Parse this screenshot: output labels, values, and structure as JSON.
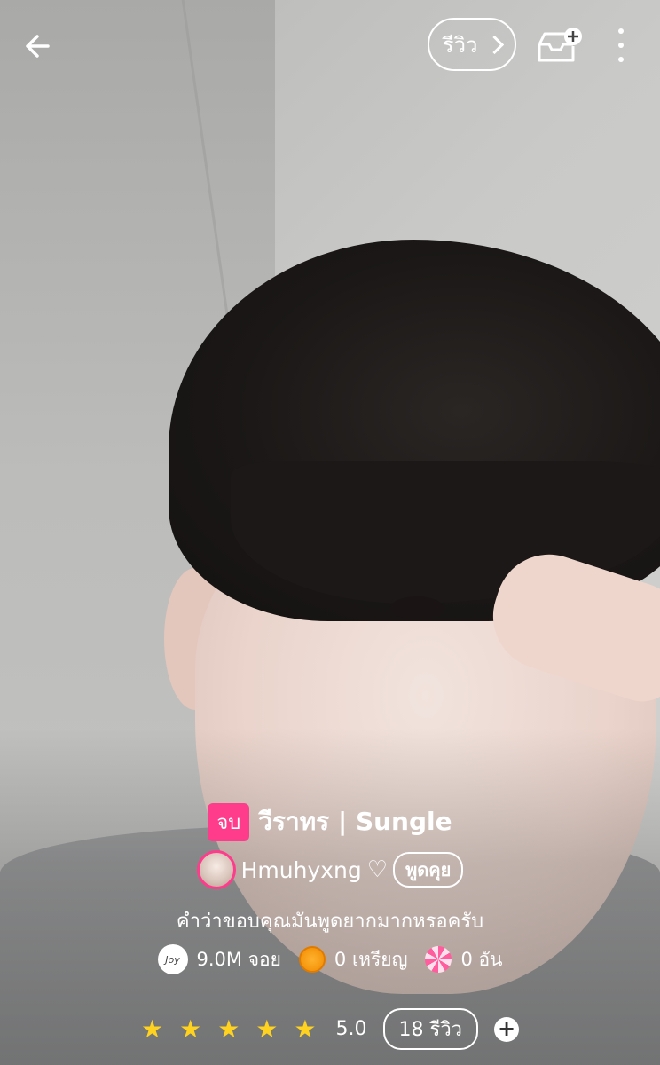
{
  "topbar": {
    "back_icon": "arrow-left-icon",
    "review_label": "รีวิว",
    "inbox_icon": "inbox-plus-icon",
    "more_icon": "kebab-menu-icon"
  },
  "story": {
    "status_badge": "จบ",
    "title": "วีราทร | Sungle",
    "author": "Hmuhyxng",
    "heart": "♡",
    "talk_label": "พูดคุย",
    "description": "คำว่าขอบคุณมันพูดยากมากหรอครับ"
  },
  "stats": {
    "joy_icon_text": "Joy",
    "joy": "9.0M จอย",
    "coins": "0 เหรียญ",
    "candy": "0 อัน"
  },
  "rating": {
    "stars": 5,
    "score": "5.0",
    "reviews_label": "18 รีวิว",
    "add_symbol": "+"
  },
  "colors": {
    "accent": "#ff3b8b",
    "star": "#ffd21f",
    "text": "#ffffff"
  }
}
